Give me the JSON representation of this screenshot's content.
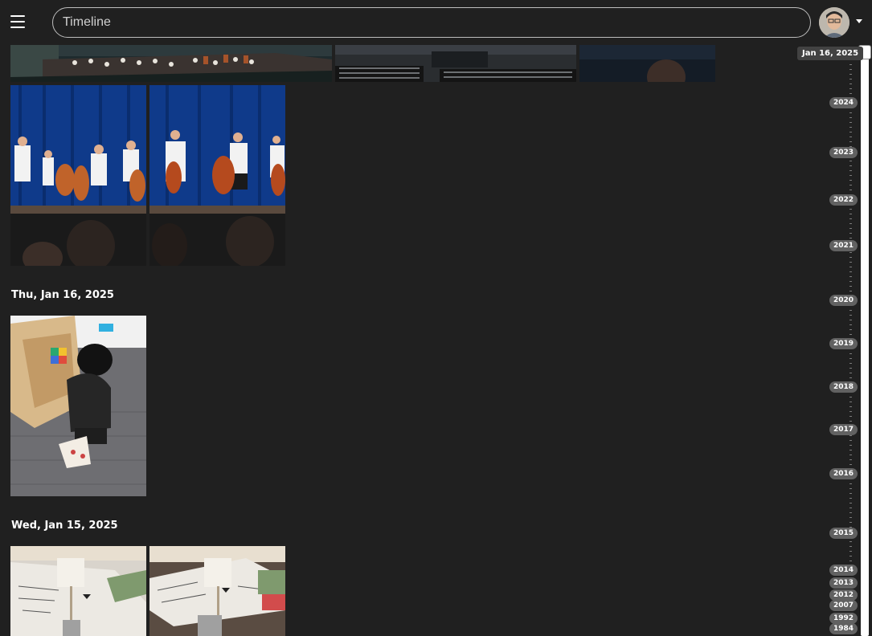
{
  "header": {
    "search_placeholder": "Timeline",
    "menu_icon": "hamburger-menu-icon",
    "avatar_icon": "user-avatar",
    "caret_icon": "caret-down-icon"
  },
  "groups": [
    {
      "label": "",
      "photos": [
        "concert-wide-1",
        "concert-hall-audience",
        "concert-hall-dark"
      ]
    },
    {
      "label": "",
      "photos": [
        "cello-section-1",
        "cello-section-2"
      ]
    },
    {
      "label": "Thu, Jan 16, 2025",
      "photos": [
        "child-playing-toy"
      ]
    },
    {
      "label": "Wed, Jan 15, 2025",
      "photos": [
        "paper-craft-1",
        "paper-craft-2"
      ]
    }
  ],
  "scrubber": {
    "current_date": "Jan 16, 2025",
    "years": [
      "2024",
      "2023",
      "2022",
      "2021",
      "2020",
      "2019",
      "2018",
      "2017",
      "2016",
      "2015",
      "2014",
      "2013",
      "2012",
      "2007",
      "1992",
      "1984"
    ]
  },
  "colors": {
    "background": "#202020",
    "pill": "#616161",
    "stage_curtain": "#0f3a8a"
  }
}
